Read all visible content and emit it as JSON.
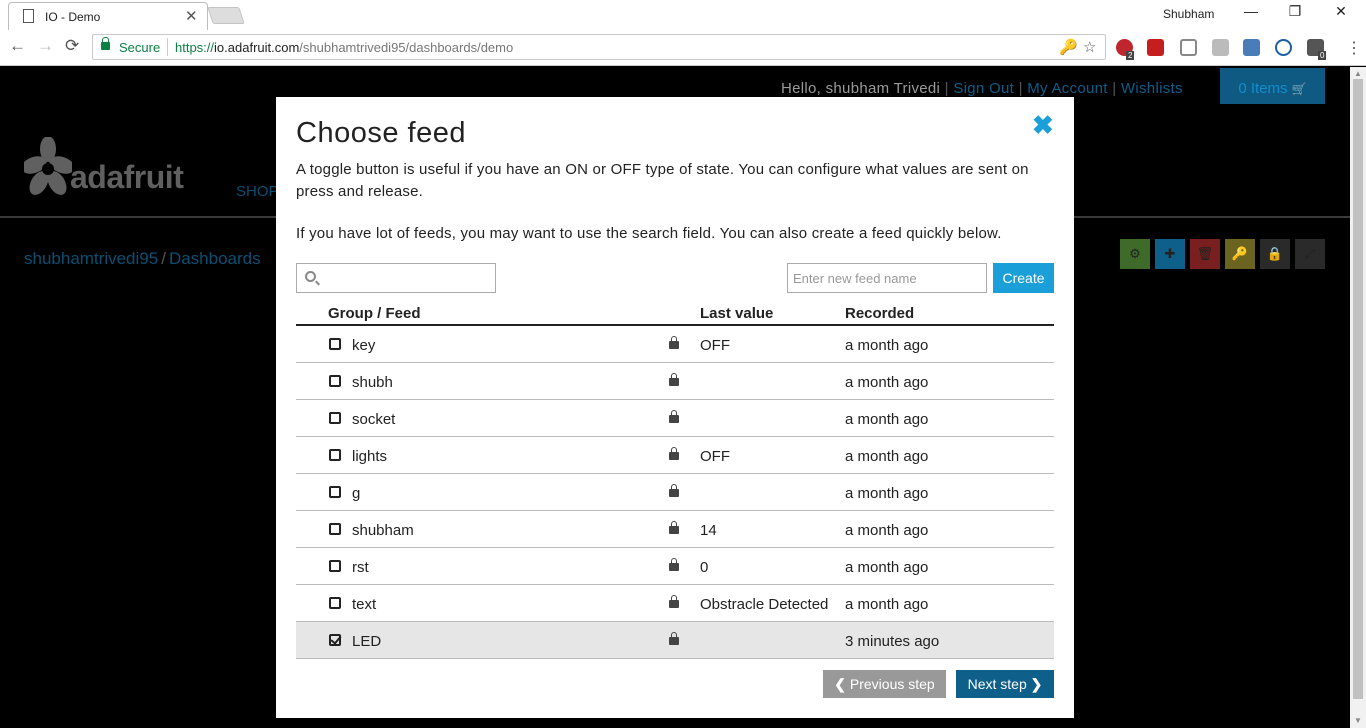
{
  "browser": {
    "tab_title": "IO - Demo",
    "tab_close": "✕",
    "profile": "Shubham",
    "minimize": "—",
    "restore": "❐",
    "close": "✕",
    "back": "←",
    "forward": "→",
    "reload": "⟳",
    "secure_label": "Secure",
    "url_scheme": "https://",
    "url_host": "io.adafruit.com",
    "url_path": "/shubhamtrivedi95/dashboards/demo",
    "key_icon": "🔑",
    "star_icon": "☆",
    "abp_badge": "2",
    "ext_badge": "0",
    "menu": "⋮"
  },
  "header": {
    "greeting": "Hello, shubham Trivedi",
    "sign_out": "Sign Out",
    "my_account": "My Account",
    "wishlists": "Wishlists",
    "sep": "|",
    "cart": "0 Items",
    "cart_icon": "🛒",
    "logo_text": "adafruit",
    "shop": "SHOP"
  },
  "breadcrumb": {
    "user": "shubhamtrivedi95",
    "slash": "/",
    "section": "Dashboards"
  },
  "dash_tools": [
    {
      "name": "settings-tool",
      "glyph": "⚙",
      "color": "#3f6b2a"
    },
    {
      "name": "add-block-tool",
      "glyph": "✚",
      "color": "#0e5f8a"
    },
    {
      "name": "delete-tool",
      "glyph": "🗑",
      "color": "#7a1f1f"
    },
    {
      "name": "key-tool",
      "glyph": "🔑",
      "color": "#6b6420"
    },
    {
      "name": "lock-tool",
      "glyph": "🔒",
      "color": "#2a2a2a"
    },
    {
      "name": "fullscreen-tool",
      "glyph": "⤢",
      "color": "#2a2a2a"
    }
  ],
  "modal": {
    "title": "Choose feed",
    "close": "✖",
    "description": "A toggle button is useful if you have an ON or OFF type of state. You can configure what values are sent on press and release.",
    "search_hint": "If you have lot of feeds, you may want to use the search field. You can also create a feed quickly below.",
    "search_value": "",
    "new_feed_placeholder": "Enter new feed name",
    "create_label": "Create",
    "columns": {
      "feed": "Group / Feed",
      "last_value": "Last value",
      "recorded": "Recorded"
    },
    "rows": [
      {
        "name": "key",
        "last": "OFF",
        "recorded": "a month ago",
        "checked": false
      },
      {
        "name": "shubh",
        "last": "",
        "recorded": "a month ago",
        "checked": false
      },
      {
        "name": "socket",
        "last": "",
        "recorded": "a month ago",
        "checked": false
      },
      {
        "name": "lights",
        "last": "OFF",
        "recorded": "a month ago",
        "checked": false
      },
      {
        "name": "g",
        "last": "",
        "recorded": "a month ago",
        "checked": false
      },
      {
        "name": "shubham",
        "last": "14",
        "recorded": "a month ago",
        "checked": false
      },
      {
        "name": "rst",
        "last": "0",
        "recorded": "a month ago",
        "checked": false
      },
      {
        "name": "text",
        "last": "Obstracle Detected",
        "recorded": "a month ago",
        "checked": false
      },
      {
        "name": "LED",
        "last": "",
        "recorded": "3 minutes ago",
        "checked": true
      }
    ],
    "prev_label": "Previous step",
    "prev_icon": "❮",
    "next_label": "Next step",
    "next_icon": "❯"
  },
  "colors": {
    "accent": "#1a9fd8",
    "next_button": "#0e5f8a",
    "prev_button": "#999999",
    "selected_row": "#e6e6e6"
  }
}
